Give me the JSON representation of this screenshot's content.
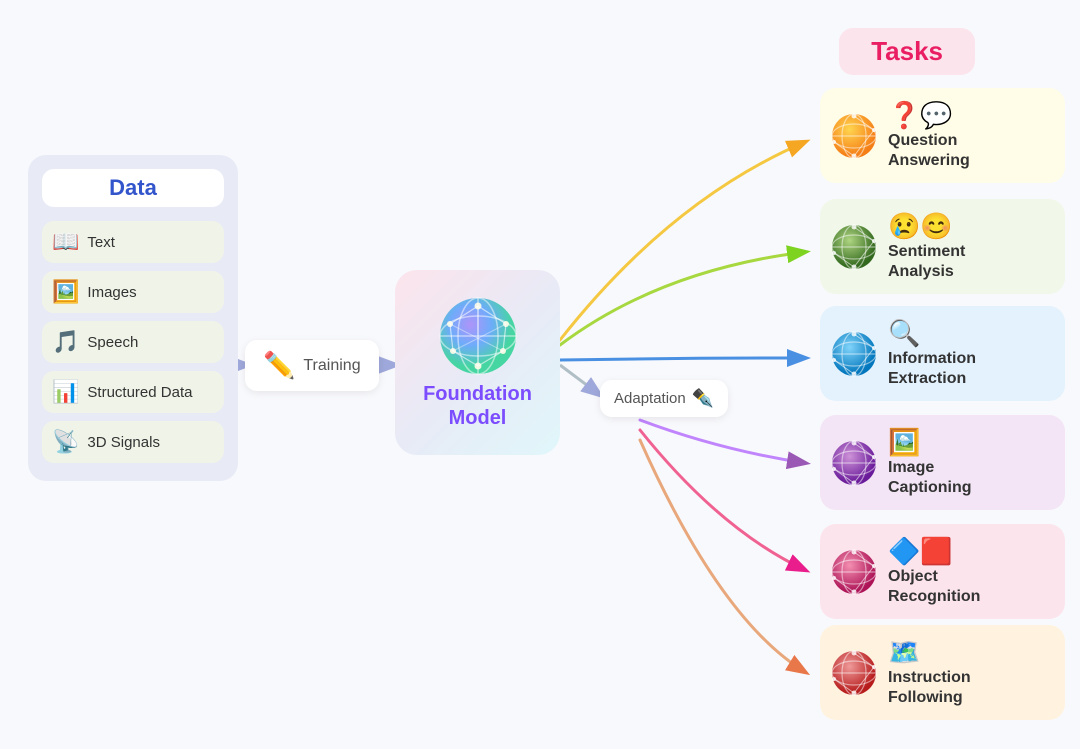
{
  "data_panel": {
    "title": "Data",
    "items": [
      {
        "label": "Text",
        "emoji": "📖"
      },
      {
        "label": "Images",
        "emoji": "🖼️"
      },
      {
        "label": "Speech",
        "emoji": "🎵"
      },
      {
        "label": "Structured Data",
        "emoji": "📊"
      },
      {
        "label": "3D Signals",
        "emoji": "📡"
      }
    ]
  },
  "training": {
    "label": "Training"
  },
  "adaptation": {
    "label": "Adaptation"
  },
  "foundation": {
    "title": "Foundation\nModel"
  },
  "tasks": {
    "header": "Tasks",
    "items": [
      {
        "label": "Question\nAnswering",
        "color_class": "task-qa",
        "globe_color": "#f5a623"
      },
      {
        "label": "Sentiment\nAnalysis",
        "color_class": "task-sentiment",
        "globe_color": "#7ed321"
      },
      {
        "label": "Information\nExtraction",
        "color_class": "task-extraction",
        "globe_color": "#4a90e2"
      },
      {
        "label": "Image\nCaptioning",
        "color_class": "task-captioning",
        "globe_color": "#9b59b6"
      },
      {
        "label": "Object\nRecognition",
        "color_class": "task-object",
        "globe_color": "#e91e8c"
      },
      {
        "label": "Instruction\nFollowing",
        "color_class": "task-instruction",
        "globe_color": "#e74c3c"
      }
    ]
  }
}
